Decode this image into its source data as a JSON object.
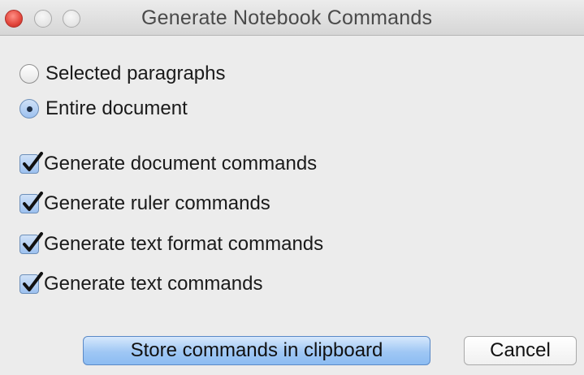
{
  "window": {
    "title": "Generate Notebook Commands"
  },
  "scope": {
    "options": [
      {
        "label": "Selected paragraphs",
        "selected": false
      },
      {
        "label": "Entire document",
        "selected": true
      }
    ]
  },
  "generate": {
    "options": [
      {
        "label": "Generate document commands",
        "checked": true
      },
      {
        "label": "Generate ruler commands",
        "checked": true
      },
      {
        "label": "Generate text format commands",
        "checked": true
      },
      {
        "label": "Generate text commands",
        "checked": true
      }
    ]
  },
  "buttons": {
    "store_label": "Store commands in clipboard",
    "cancel_label": "Cancel"
  },
  "colors": {
    "close_button": "#e2463c",
    "accent": "#9dc1ef"
  },
  "icons": {
    "close": "close-icon",
    "minimize": "minimize-icon",
    "zoom": "zoom-icon",
    "check": "checkmark-icon"
  }
}
